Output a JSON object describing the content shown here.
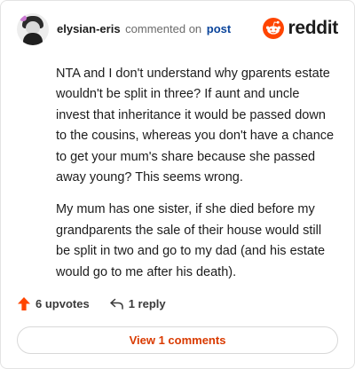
{
  "header": {
    "username": "elysian-eris",
    "action_text": "commented on",
    "post_link": "post",
    "brand_name": "reddit"
  },
  "comment": {
    "paragraphs": [
      "NTA and I don't understand why gparents estate wouldn't be split in three? If aunt and uncle invest that inheritance it would be passed down to the cousins, whereas you don't have a chance to get your mum's share because she passed away young? This seems wrong.",
      "My mum has one sister, if she died before my grandparents the sale of their house would still be split in two and go to my dad (and his estate would go to me after his death)."
    ]
  },
  "actions": {
    "upvotes_label": "6 upvotes",
    "reply_label": "1 reply"
  },
  "footer": {
    "view_comments_label": "View 1 comments"
  },
  "colors": {
    "brand_orange": "#ff4500",
    "link_blue": "#0a449b",
    "button_text": "#d93a00"
  },
  "icons": {
    "upvote": "upvote-arrow-icon",
    "reply": "reply-arrow-icon",
    "brand": "reddit-snoo-icon"
  }
}
